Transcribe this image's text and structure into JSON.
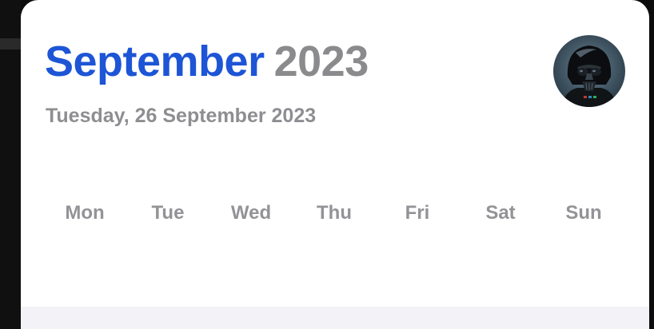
{
  "header": {
    "month": "September",
    "year": "2023",
    "date_label": "Tuesday, 26 September 2023"
  },
  "avatar": {
    "icon": "darth-vader-avatar"
  },
  "weekdays": [
    "Mon",
    "Tue",
    "Wed",
    "Thu",
    "Fri",
    "Sat",
    "Sun"
  ],
  "colors": {
    "accent": "#1d55d6",
    "secondary_text": "#8e8e92",
    "background": "#ffffff",
    "bottom_band": "#f2f2f7"
  }
}
